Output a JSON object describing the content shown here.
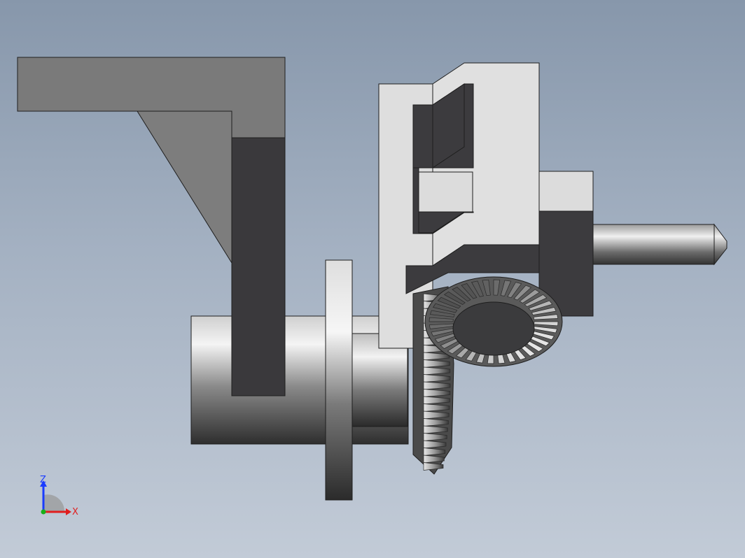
{
  "viewport": {
    "background_top": "#8797ab",
    "background_bottom": "#c2cbd7"
  },
  "colors": {
    "bracket_light": "#7c7c7c",
    "bracket_face": "#8a8a8a",
    "bracket_dark": "#3a393c",
    "housing_light": "#dcdcdc",
    "housing_dark": "#3c3b3e",
    "shaft_light": "#f2f2f2",
    "shaft_dark": "#3a3a3a",
    "gear_tooth": "#9a9a9a",
    "edge": "#1e1e1e"
  },
  "model": {
    "parts": [
      "bracket",
      "housing",
      "main-shaft",
      "flange-disk",
      "vertical-bevel-gear",
      "horizontal-bevel-gear",
      "output-shaft"
    ]
  },
  "triad": {
    "z_label": "Z",
    "x_label": "X",
    "z_color": "#1a3cff",
    "x_color": "#e01e1e",
    "y_color": "#18b018"
  }
}
